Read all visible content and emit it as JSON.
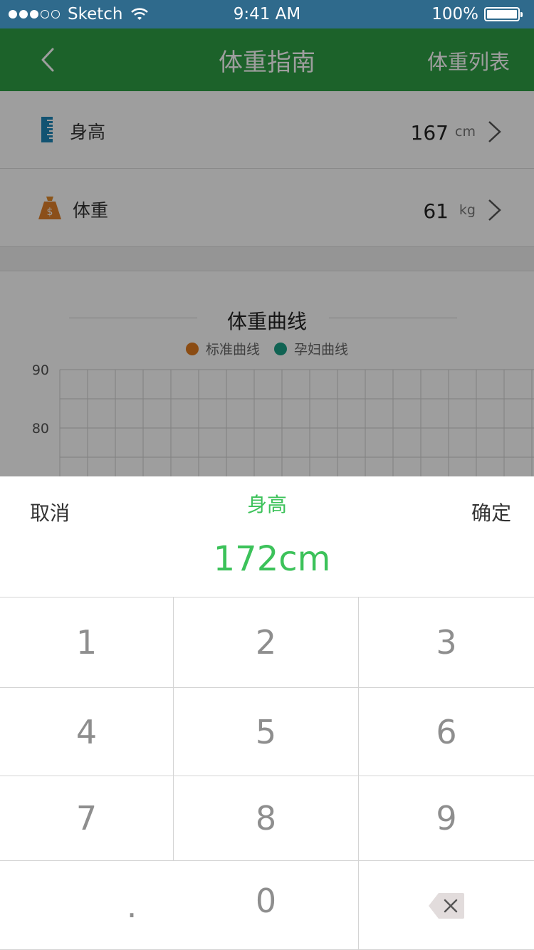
{
  "status_bar": {
    "carrier": "Sketch",
    "time": "9:41 AM",
    "battery": "100%",
    "signal_icon": "signal-dots-icon",
    "wifi_icon": "wifi-icon",
    "battery_icon": "battery-icon",
    "battery_level": 1.0
  },
  "nav": {
    "title": "体重指南",
    "right_button": "体重列表",
    "back_icon": "chevron-left-icon",
    "color": "#2e9e45"
  },
  "rows": [
    {
      "icon": "ruler-icon",
      "label": "身高",
      "value": "167",
      "unit": "cm",
      "chevron": "chevron-right-icon"
    },
    {
      "icon": "weight-bag-icon",
      "label": "体重",
      "value": "61",
      "unit": "kg",
      "chevron": "chevron-right-icon"
    }
  ],
  "chart": {
    "title": "体重曲线",
    "legend": [
      {
        "label": "标准曲线",
        "color": "#e07b1f"
      },
      {
        "label": "孕妇曲线",
        "color": "#1aa086"
      }
    ],
    "y_ticks": [
      "90",
      "80"
    ]
  },
  "chart_data": {
    "type": "line",
    "title": "体重曲线",
    "series": [
      {
        "name": "标准曲线",
        "values": []
      },
      {
        "name": "孕妇曲线",
        "values": []
      }
    ],
    "y_ticks": [
      90,
      80
    ],
    "grid": true,
    "legend_position": "top-center"
  },
  "keypad": {
    "cancel": "取消",
    "confirm": "确定",
    "title": "身高",
    "value": "172",
    "unit": "cm",
    "accent_color": "#3cc25a",
    "keys": [
      "1",
      "2",
      "3",
      "4",
      "5",
      "6",
      "7",
      "8",
      "9",
      ".",
      "0"
    ],
    "backspace_icon": "backspace-icon"
  }
}
